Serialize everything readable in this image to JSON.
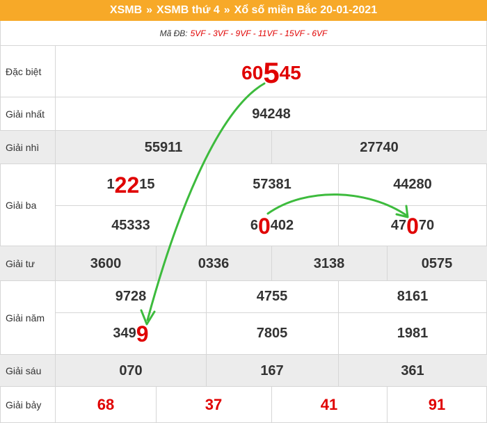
{
  "header": {
    "link1": "XSMB",
    "sep1": "»",
    "link2": "XSMB thứ 4",
    "sep2": "»",
    "title": "Xổ số miền Bắc 20-01-2021"
  },
  "madb": {
    "label": "Mã ĐB:",
    "codes": "5VF - 3VF - 9VF - 11VF - 15VF - 6VF"
  },
  "prizes": {
    "db": {
      "label": "Đặc biệt",
      "pre": "60",
      "hl": "5",
      "post": "45"
    },
    "nhat": {
      "label": "Giải nhất",
      "values": [
        "94248"
      ]
    },
    "nhi": {
      "label": "Giải nhì",
      "values": [
        "55911",
        "27740"
      ]
    },
    "ba": {
      "label": "Giải ba",
      "r1c1": {
        "pre": "1",
        "hl": "22",
        "post": "15"
      },
      "r1c2": "57381",
      "r1c3": "44280",
      "r2c1": "45333",
      "r2c2": {
        "pre": "6",
        "hl": "0",
        "post": "402"
      },
      "r2c3": {
        "pre": "47",
        "hl": "0",
        "post": "70"
      }
    },
    "tu": {
      "label": "Giải tư",
      "values": [
        "3600",
        "0336",
        "3138",
        "0575"
      ]
    },
    "nam": {
      "label": "Giải năm",
      "r1": [
        "9728",
        "4755",
        "8161"
      ],
      "r2c1": {
        "pre": "349",
        "hl": "9"
      },
      "r2c2": "7805",
      "r2c3": "1981"
    },
    "sau": {
      "label": "Giải sáu",
      "values": [
        "070",
        "167",
        "361"
      ]
    },
    "bay": {
      "label": "Giải bảy",
      "values": [
        "68",
        "37",
        "41",
        "91"
      ]
    }
  },
  "colors": {
    "header": "#f7a928",
    "highlight": "#e00000",
    "arrow": "#3dbb3d",
    "row_grey": "#ececec"
  }
}
